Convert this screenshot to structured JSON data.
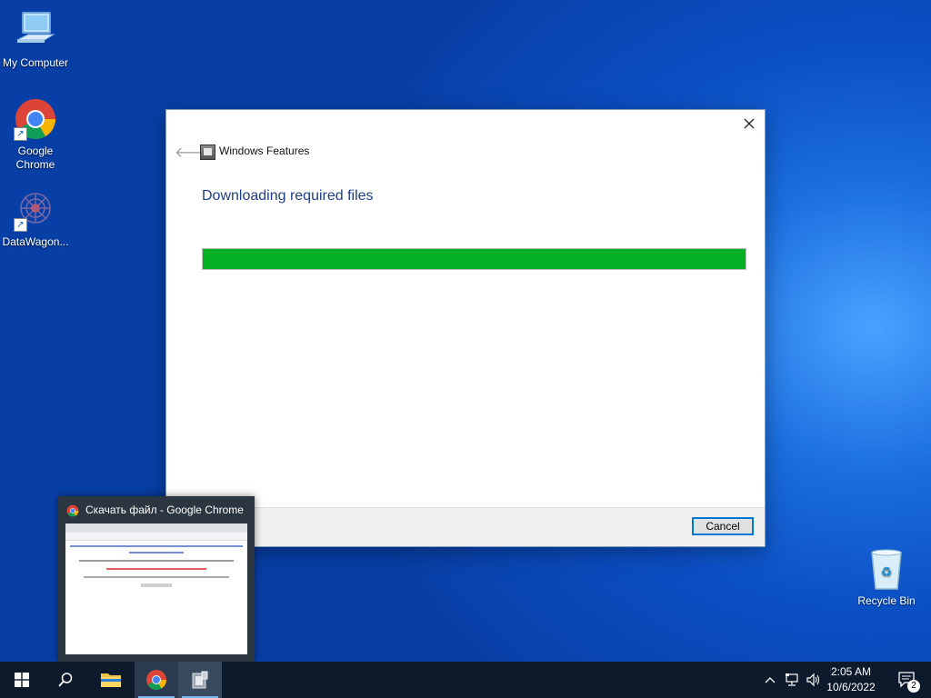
{
  "desktop": {
    "icons": [
      {
        "label": "My Computer"
      },
      {
        "label": "Google Chrome"
      },
      {
        "label": "DataWagon..."
      },
      {
        "label": "Recycle Bin"
      }
    ]
  },
  "dialog": {
    "window_title": "Windows Features",
    "heading": "Downloading required files",
    "progress": 1.0,
    "cancel_label": "Cancel"
  },
  "taskbar": {
    "thumbnail_title": "Скачать файл - Google Chrome",
    "clock": {
      "time": "2:05 AM",
      "date": "10/6/2022"
    },
    "notification_count": "2",
    "accent": "#76b9ed"
  },
  "colors": {
    "progress_fill": "#06b025",
    "heading": "#1f3f8a",
    "taskbar": "#0d1a2b"
  }
}
